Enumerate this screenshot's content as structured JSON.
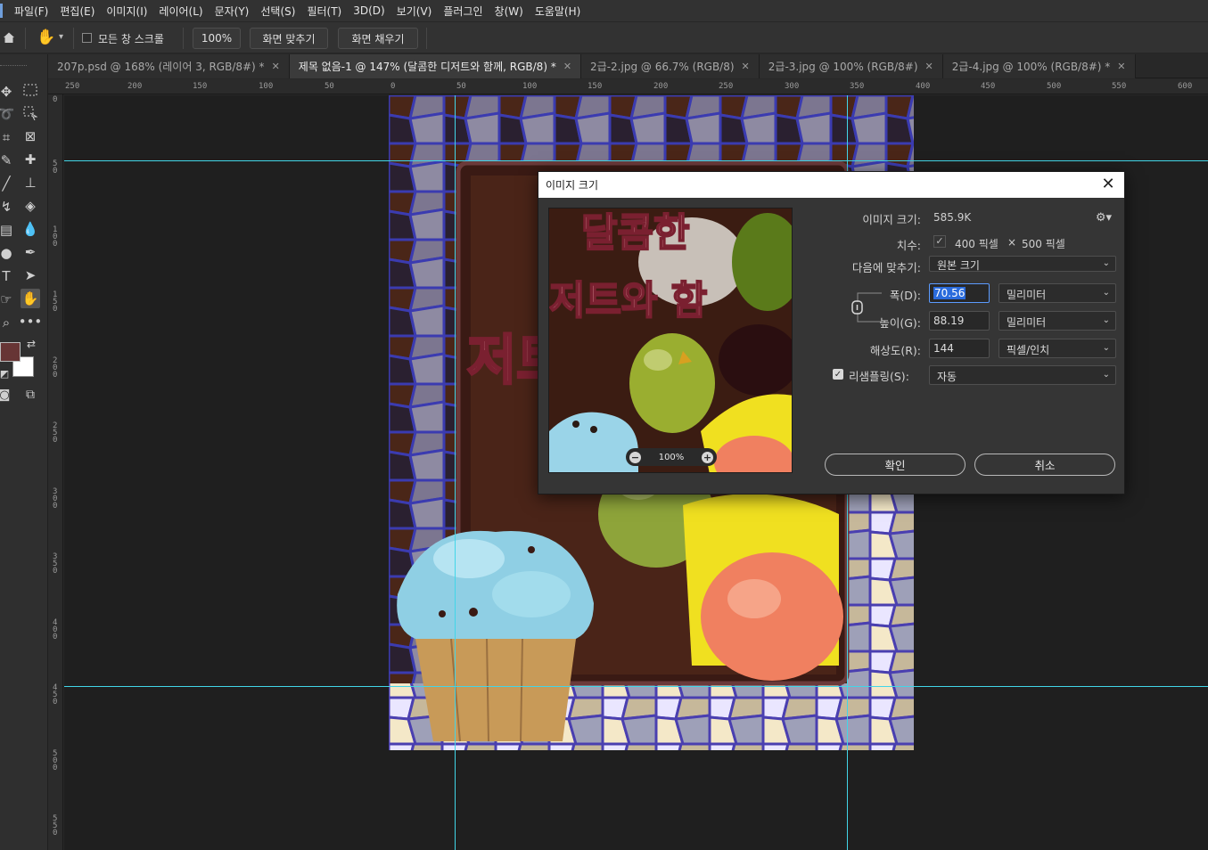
{
  "menu": [
    "파일(F)",
    "편집(E)",
    "이미지(I)",
    "레이어(L)",
    "문자(Y)",
    "선택(S)",
    "필터(T)",
    "3D(D)",
    "보기(V)",
    "플러그인",
    "창(W)",
    "도움말(H)"
  ],
  "options": {
    "scroll_all_label": "모든 창 스크롤",
    "zoom_value": "100%",
    "fit_screen_label": "화면 맞추기",
    "fill_screen_label": "화면 채우기"
  },
  "tabs": [
    {
      "label": "207p.psd @ 168% (레이어 3, RGB/8#) *",
      "active": false
    },
    {
      "label": "제목 없음-1 @ 147% (달콤한 디저트와 함께, RGB/8) *",
      "active": true
    },
    {
      "label": "2급-2.jpg @ 66.7% (RGB/8)",
      "active": false
    },
    {
      "label": "2급-3.jpg @ 100% (RGB/8#)",
      "active": false
    },
    {
      "label": "2급-4.jpg @ 100% (RGB/8#) *",
      "active": false
    }
  ],
  "ruler_h": [
    "250",
    "200",
    "150",
    "100",
    "50",
    "0",
    "50",
    "100",
    "150",
    "200",
    "250",
    "300",
    "350",
    "400",
    "450",
    "500",
    "550",
    "600"
  ],
  "ruler_v": [
    "0",
    "50",
    "100",
    "150",
    "200",
    "250",
    "300",
    "350",
    "400",
    "450",
    "500",
    "550"
  ],
  "colors": {
    "foreground": "#673535",
    "background": "#ffffff",
    "guide": "#42d6e8"
  },
  "dialog": {
    "title": "이미지 크기",
    "image_size_label": "이미지 크기:",
    "image_size_value": "585.9K",
    "dimensions_label": "치수:",
    "dimensions_w": "400 픽셀",
    "dimensions_x": "×",
    "dimensions_h": "500 픽셀",
    "fit_to_label": "다음에 맞추기:",
    "fit_to_value": "원본 크기",
    "width_label": "폭(D):",
    "width_value": "70.56",
    "width_unit": "밀리미터",
    "height_label": "높이(G):",
    "height_value": "88.19",
    "height_unit": "밀리미터",
    "resolution_label": "해상도(R):",
    "resolution_value": "144",
    "resolution_unit": "픽셀/인치",
    "resample_label": "리샘플링(S):",
    "resample_checked": true,
    "resample_value": "자동",
    "preview_zoom": "100%",
    "ok_label": "확인",
    "cancel_label": "취소"
  },
  "artwork_text": {
    "line1": "달콤한",
    "line2": "저트와 함"
  }
}
